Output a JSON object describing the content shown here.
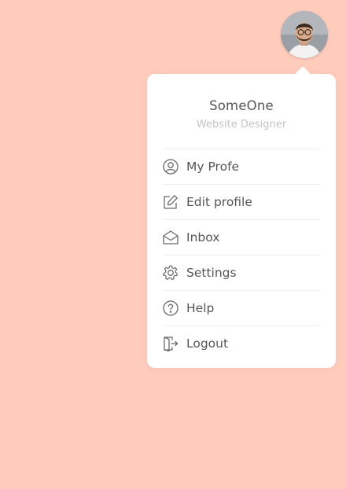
{
  "profile": {
    "name": "SomeOne",
    "role": "Website Designer"
  },
  "menu": {
    "items": [
      {
        "label": "My Profe",
        "icon": "user-circle-icon"
      },
      {
        "label": "Edit profile",
        "icon": "edit-icon"
      },
      {
        "label": "Inbox",
        "icon": "mail-open-icon"
      },
      {
        "label": "Settings",
        "icon": "gear-icon"
      },
      {
        "label": "Help",
        "icon": "help-circle-icon"
      },
      {
        "label": "Logout",
        "icon": "logout-icon"
      }
    ]
  },
  "colors": {
    "background": "#ffcbbb",
    "card": "#ffffff",
    "text": "#555555",
    "muted": "#c4c4c4"
  }
}
